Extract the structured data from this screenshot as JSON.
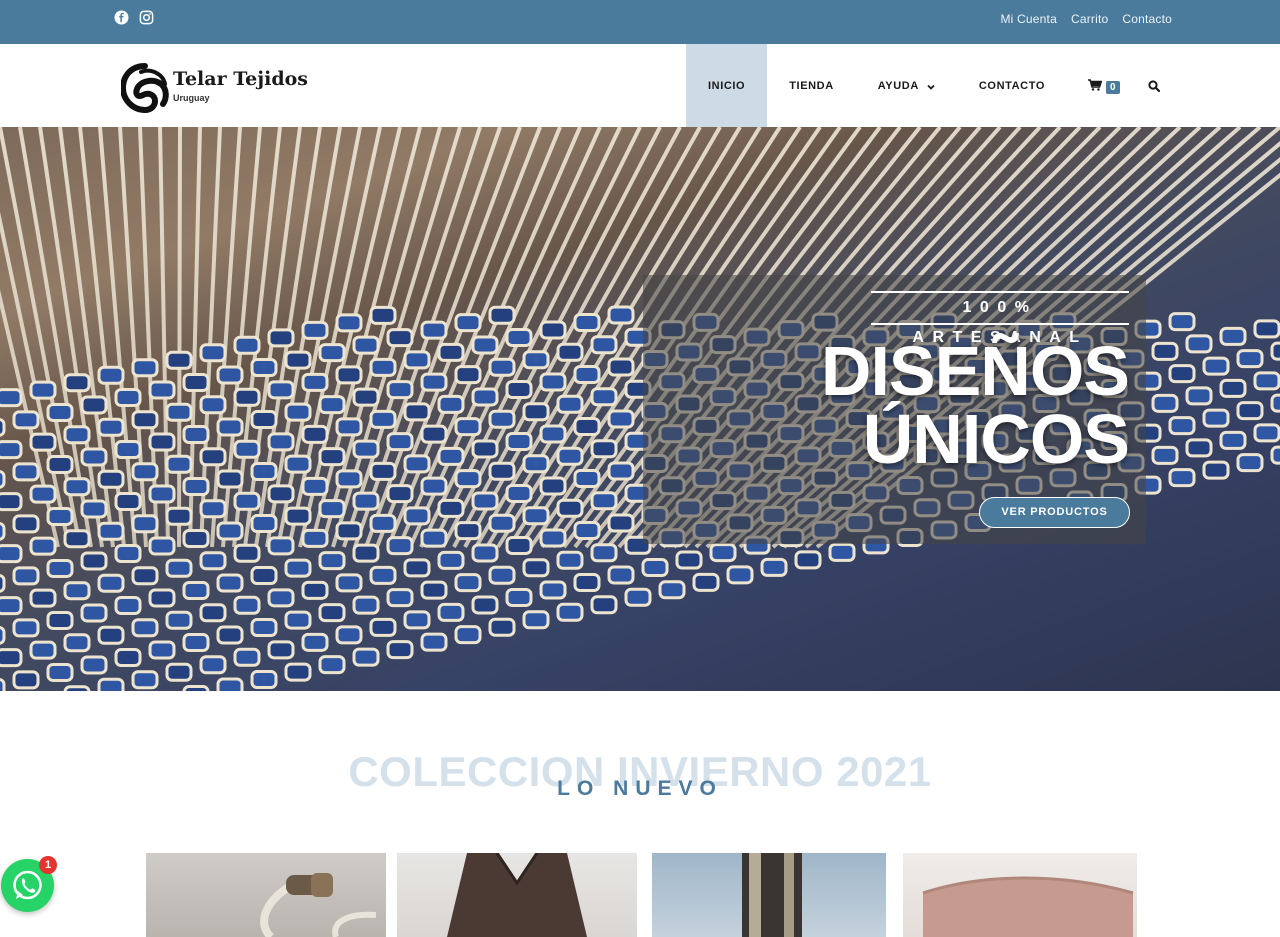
{
  "topbar": {
    "social": [
      "facebook-icon",
      "instagram-icon"
    ],
    "links": [
      "Mi Cuenta",
      "Carrito",
      "Contacto"
    ]
  },
  "header": {
    "logo_title": "Telar Tejidos",
    "logo_subtitle": "Uruguay",
    "nav": [
      {
        "label": "INICIO",
        "active": true
      },
      {
        "label": "TIENDA",
        "active": false
      },
      {
        "label": "AYUDA",
        "active": false,
        "has_dropdown": true
      },
      {
        "label": "CONTACTO",
        "active": false
      }
    ],
    "cart_count": "0",
    "cart_icon": "cart-icon",
    "search_icon": "search-icon"
  },
  "hero": {
    "kicker": "100% ARTESANAL",
    "title_line1": "DISEÑOS",
    "title_line2": "ÚNICOS",
    "button": "VER PRODUCTOS"
  },
  "section": {
    "title": "COLECCION INVIERNO 2021",
    "subtitle": "LO NUEVO"
  },
  "whatsapp": {
    "icon": "whatsapp-icon",
    "badge": "1"
  },
  "colors": {
    "brand": "#4a7a9c",
    "nav_active": "#cddbe6",
    "whatsapp": "#25d366"
  }
}
